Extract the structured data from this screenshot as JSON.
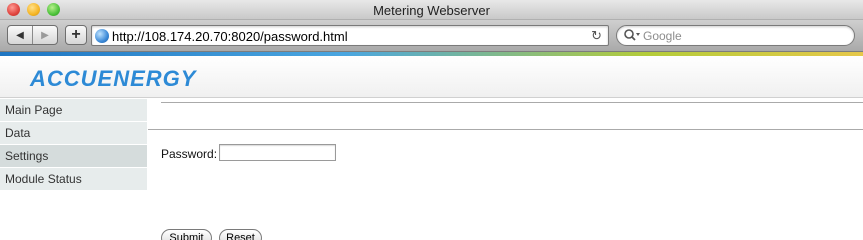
{
  "window": {
    "title": "Metering Webserver"
  },
  "toolbar": {
    "back_icon": "back-arrow-icon",
    "forward_icon": "forward-arrow-icon",
    "add_label": "+",
    "url": "http://108.174.20.70:8020/password.html",
    "reload_icon": "reload-icon",
    "search_placeholder": "Google"
  },
  "header": {
    "logo_text": "ACCUENERGY"
  },
  "sidebar": {
    "items": [
      {
        "label": "Main Page"
      },
      {
        "label": "Data"
      },
      {
        "label": "Settings"
      },
      {
        "label": "Module Status"
      }
    ]
  },
  "form": {
    "password_label": "Password:",
    "password_value": "",
    "submit_label": "Submit",
    "reset_label": "Reset"
  },
  "colors": {
    "brand_blue": "#2d8ad6",
    "sidebar_bg": "#e7ecec",
    "sidebar_active_bg": "#d5dcdc"
  }
}
